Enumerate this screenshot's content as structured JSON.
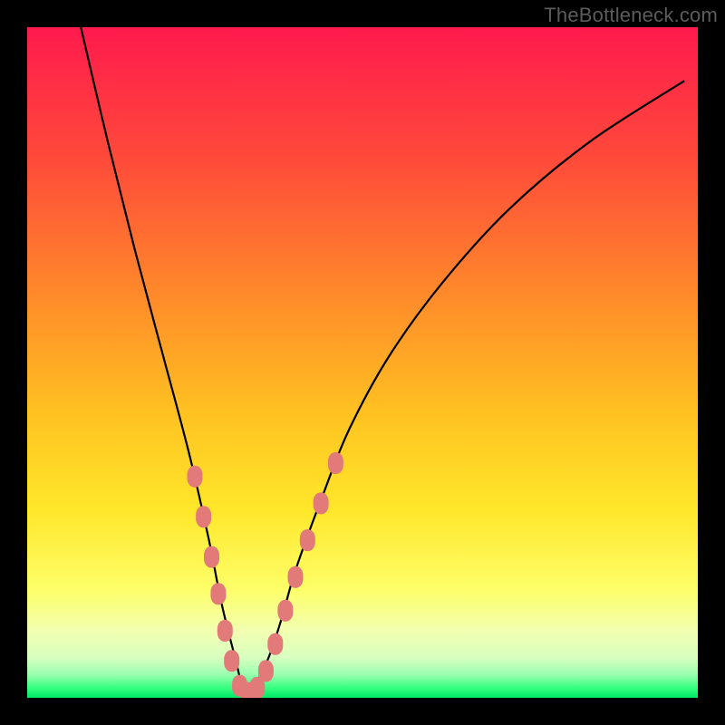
{
  "watermark": "TheBottleneck.com",
  "colors": {
    "frame": "#000000",
    "curve": "#000000",
    "marker_fill": "#e17a78",
    "marker_stroke": "#d86a68",
    "gradient_stops": [
      {
        "offset": 0.0,
        "color": "#ff1a4d"
      },
      {
        "offset": 0.2,
        "color": "#ff4b3a"
      },
      {
        "offset": 0.4,
        "color": "#ff8a2a"
      },
      {
        "offset": 0.58,
        "color": "#ffc321"
      },
      {
        "offset": 0.72,
        "color": "#ffe72a"
      },
      {
        "offset": 0.84,
        "color": "#fdff6a"
      },
      {
        "offset": 0.9,
        "color": "#f2ffb0"
      },
      {
        "offset": 0.94,
        "color": "#d8ffc0"
      },
      {
        "offset": 0.965,
        "color": "#9cffb0"
      },
      {
        "offset": 0.985,
        "color": "#35ff80"
      },
      {
        "offset": 1.0,
        "color": "#00e865"
      }
    ]
  },
  "chart_data": {
    "type": "line",
    "title": "",
    "xlabel": "",
    "ylabel": "",
    "xlim": [
      0,
      100
    ],
    "ylim": [
      0,
      100
    ],
    "grid": false,
    "legend": false,
    "series": [
      {
        "name": "bottleneck-curve",
        "description": "V-shaped bottleneck curve. Values are approximate percentage bottleneck (y) vs relative component balance (x), read from the gradient scale (top=100, bottom=0).",
        "x": [
          8,
          12,
          16,
          20,
          24,
          27,
          29,
          31,
          32.5,
          34,
          36,
          38,
          40,
          44,
          48,
          54,
          62,
          72,
          84,
          98
        ],
        "y": [
          100,
          83,
          67,
          52,
          37,
          24,
          14,
          6,
          0.5,
          2,
          6,
          12,
          19,
          30,
          40,
          51,
          62,
          73,
          83,
          92
        ]
      }
    ],
    "markers": {
      "description": "Pink rounded markers clustered near the valley on both sides of the curve.",
      "points": [
        {
          "x": 25.0,
          "y": 33.0
        },
        {
          "x": 26.3,
          "y": 27.0
        },
        {
          "x": 27.5,
          "y": 21.0
        },
        {
          "x": 28.5,
          "y": 15.5
        },
        {
          "x": 29.5,
          "y": 10.0
        },
        {
          "x": 30.5,
          "y": 5.5
        },
        {
          "x": 31.7,
          "y": 1.8
        },
        {
          "x": 33.0,
          "y": 0.7
        },
        {
          "x": 34.3,
          "y": 1.5
        },
        {
          "x": 35.6,
          "y": 4.0
        },
        {
          "x": 37.0,
          "y": 8.0
        },
        {
          "x": 38.5,
          "y": 13.0
        },
        {
          "x": 40.0,
          "y": 18.0
        },
        {
          "x": 41.8,
          "y": 23.5
        },
        {
          "x": 43.8,
          "y": 29.0
        },
        {
          "x": 46.0,
          "y": 35.0
        }
      ]
    }
  }
}
